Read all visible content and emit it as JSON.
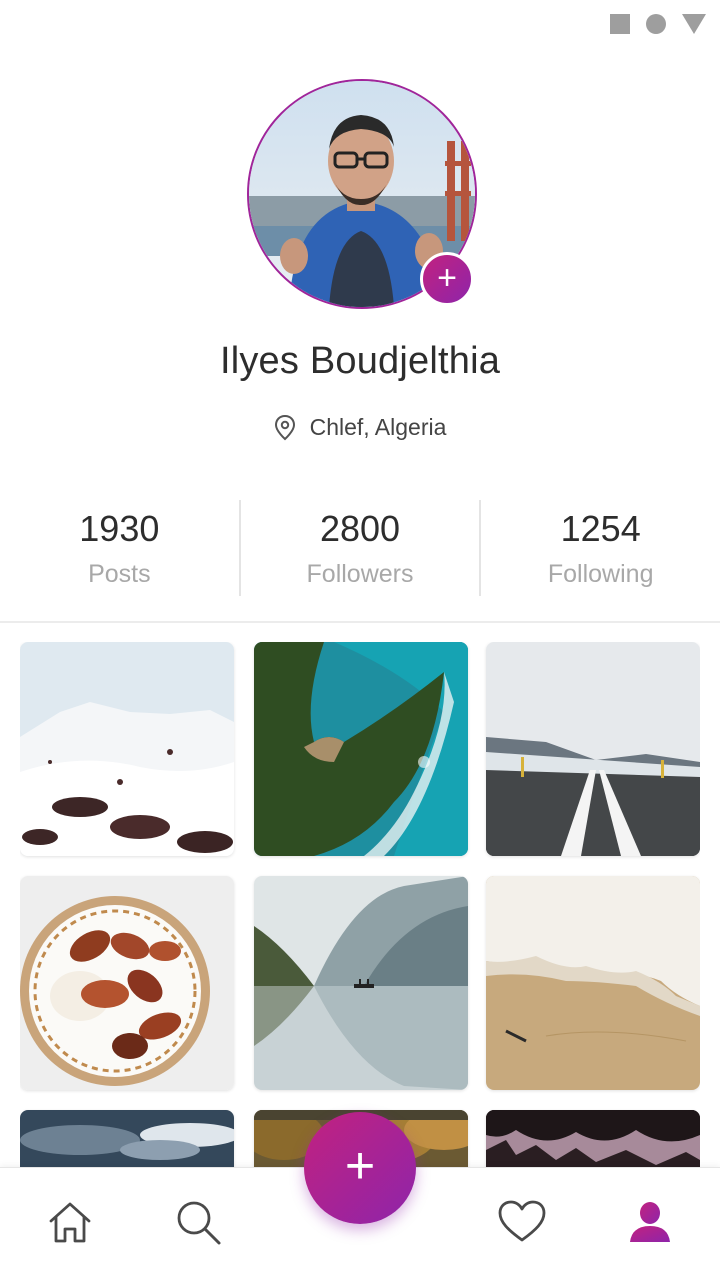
{
  "status_bar": {
    "icons": [
      "square-icon",
      "circle-icon",
      "triangle-icon"
    ]
  },
  "profile": {
    "name": "Ilyes Boudjelthia",
    "location": "Chlef, Algeria",
    "add_photo_label": "+"
  },
  "stats": [
    {
      "value": "1930",
      "label": "Posts"
    },
    {
      "value": "2800",
      "label": "Followers"
    },
    {
      "value": "1254",
      "label": "Following"
    }
  ],
  "gallery": {
    "photos": [
      "snowy mountain",
      "aerial coastline",
      "empty road",
      "plate of figs",
      "misty lake",
      "sand and foam",
      "dark sky",
      "autumn forest",
      "night trees"
    ]
  },
  "bottom_nav": {
    "items": [
      "home-icon",
      "search-icon",
      "heart-icon",
      "profile-icon"
    ],
    "fab_label": "+"
  },
  "colors": {
    "accent": "#9c27b0",
    "accent_pink": "#c2227f",
    "muted_text": "#a8a8a8"
  }
}
